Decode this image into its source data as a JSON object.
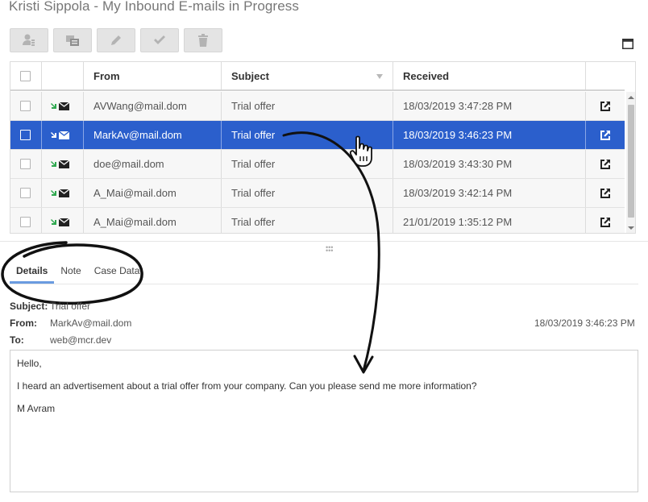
{
  "window": {
    "title": "Kristi Sippola - My Inbound E-mails in Progress"
  },
  "toolbar": {
    "buttons": [
      {
        "icon": "user-info-icon"
      },
      {
        "icon": "transfer-icon"
      },
      {
        "icon": "pencil-icon"
      },
      {
        "icon": "checkmark-icon"
      },
      {
        "icon": "trash-icon"
      }
    ]
  },
  "grid": {
    "columns": {
      "from": "From",
      "subject": "Subject",
      "received": "Received"
    },
    "rows": [
      {
        "from": "AVWang@mail.dom",
        "subject": "Trial offer",
        "received": "18/03/2019 3:47:28 PM",
        "selected": false
      },
      {
        "from": "MarkAv@mail.dom",
        "subject": "Trial offer",
        "received": "18/03/2019 3:46:23 PM",
        "selected": true
      },
      {
        "from": "doe@mail.dom",
        "subject": "Trial offer",
        "received": "18/03/2019 3:43:30 PM",
        "selected": false
      },
      {
        "from": "A_Mai@mail.dom",
        "subject": "Trial offer",
        "received": "18/03/2019 3:42:14 PM",
        "selected": false
      },
      {
        "from": "A_Mai@mail.dom",
        "subject": "Trial offer",
        "received": "21/01/2019 1:35:12 PM",
        "selected": false
      }
    ]
  },
  "tabs": {
    "details": "Details",
    "note": "Note",
    "case_data": "Case Data"
  },
  "details": {
    "subject_label": "Subject:",
    "subject_value": "Trial offer",
    "from_label": "From:",
    "from_value": "MarkAv@mail.dom",
    "to_label": "To:",
    "to_value": "web@mcr.dev",
    "date": "18/03/2019 3:46:23 PM"
  },
  "message": {
    "greeting": "Hello,",
    "body": "I heard an advertisement about a trial offer from your company. Can you please send me more information?",
    "signature": "M Avram"
  },
  "colors": {
    "selected_row": "#2b5fcc",
    "tab_underline": "#6a9be0",
    "inbound_arrow": "#2fa84f"
  }
}
